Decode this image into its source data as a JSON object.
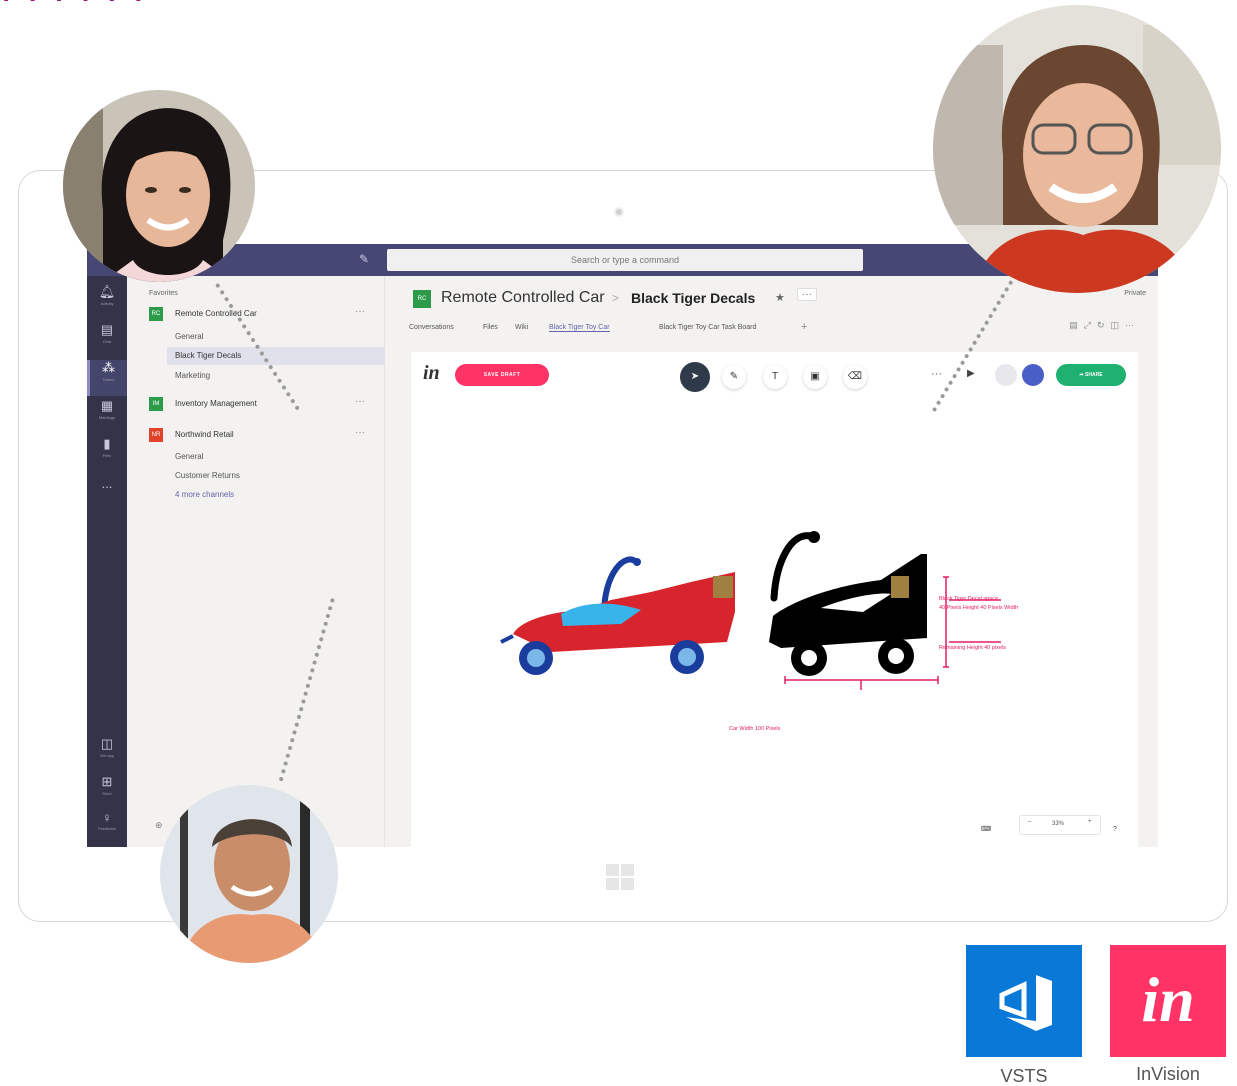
{
  "banner_fragment": "ı ı ı ı ı ı",
  "teams": {
    "search_placeholder": "Search or type a command",
    "rail": [
      {
        "icon": "bell-icon",
        "label": "Activity"
      },
      {
        "icon": "chat-icon",
        "label": "Chat"
      },
      {
        "icon": "teams-icon",
        "label": "Teams"
      },
      {
        "icon": "meetings-icon",
        "label": "Meetings"
      },
      {
        "icon": "files-icon",
        "label": "Files"
      },
      {
        "icon": "more-icon",
        "label": "..."
      },
      {
        "icon": "store-icon",
        "label": "Get app"
      },
      {
        "icon": "apps-icon",
        "label": "Store"
      },
      {
        "icon": "feedback-icon",
        "label": "Feedback"
      }
    ],
    "favorites_label": "Favorites",
    "sidebar": {
      "team1": {
        "name": "Remote Controlled Car",
        "initials": "RC",
        "more": "···"
      },
      "team1_channels": [
        "General",
        "Black Tiger Decals",
        "Marketing"
      ],
      "team2": {
        "name": "Inventory Management",
        "initials": "IM",
        "more": "···"
      },
      "team3": {
        "name": "Northwind Retail",
        "initials": "NR",
        "more": "···"
      },
      "team3_channels": [
        "General",
        "Customer Returns"
      ],
      "more_channels": "4 more channels"
    },
    "header": {
      "team": "Remote Controlled Car",
      "separator": ">",
      "channel": "Black Tiger Decals",
      "star": "★",
      "more": "···",
      "privacy": "Private",
      "initials": "RC"
    },
    "tabs": [
      "Conversations",
      "Files",
      "Wiki",
      "Black Tiger Toy Car",
      "Black Tiger Toy Car Task Board"
    ],
    "tab_add": "+"
  },
  "invision": {
    "logo": "in",
    "save_draft": "SAVE DRAFT",
    "share": "SHARE",
    "more": "···",
    "tools": [
      "pointer-icon",
      "pen-icon",
      "text-icon",
      "image-icon",
      "eraser-icon"
    ],
    "tool_text": "T",
    "annotations": {
      "decal_1": "Black Tiger Decal space",
      "decal_2": "40 Pixels Height  40 Pixels Width",
      "remaining": "Remaining Height 40 pixels",
      "car_width": "Car Width 100 Pixels"
    },
    "zoom": {
      "minus": "–",
      "value": "33%",
      "plus": "+"
    },
    "help": "?"
  },
  "apps": [
    {
      "name": "VSTS",
      "color": "#0a78d7"
    },
    {
      "name": "InVision",
      "color": "#ff3366",
      "glyph": "in"
    }
  ],
  "colors": {
    "teams_purple": "#464775",
    "rail": "#33344a",
    "invision_pink": "#ff3366",
    "share_green": "#1fb16f",
    "annotation": "#e51f5f"
  }
}
